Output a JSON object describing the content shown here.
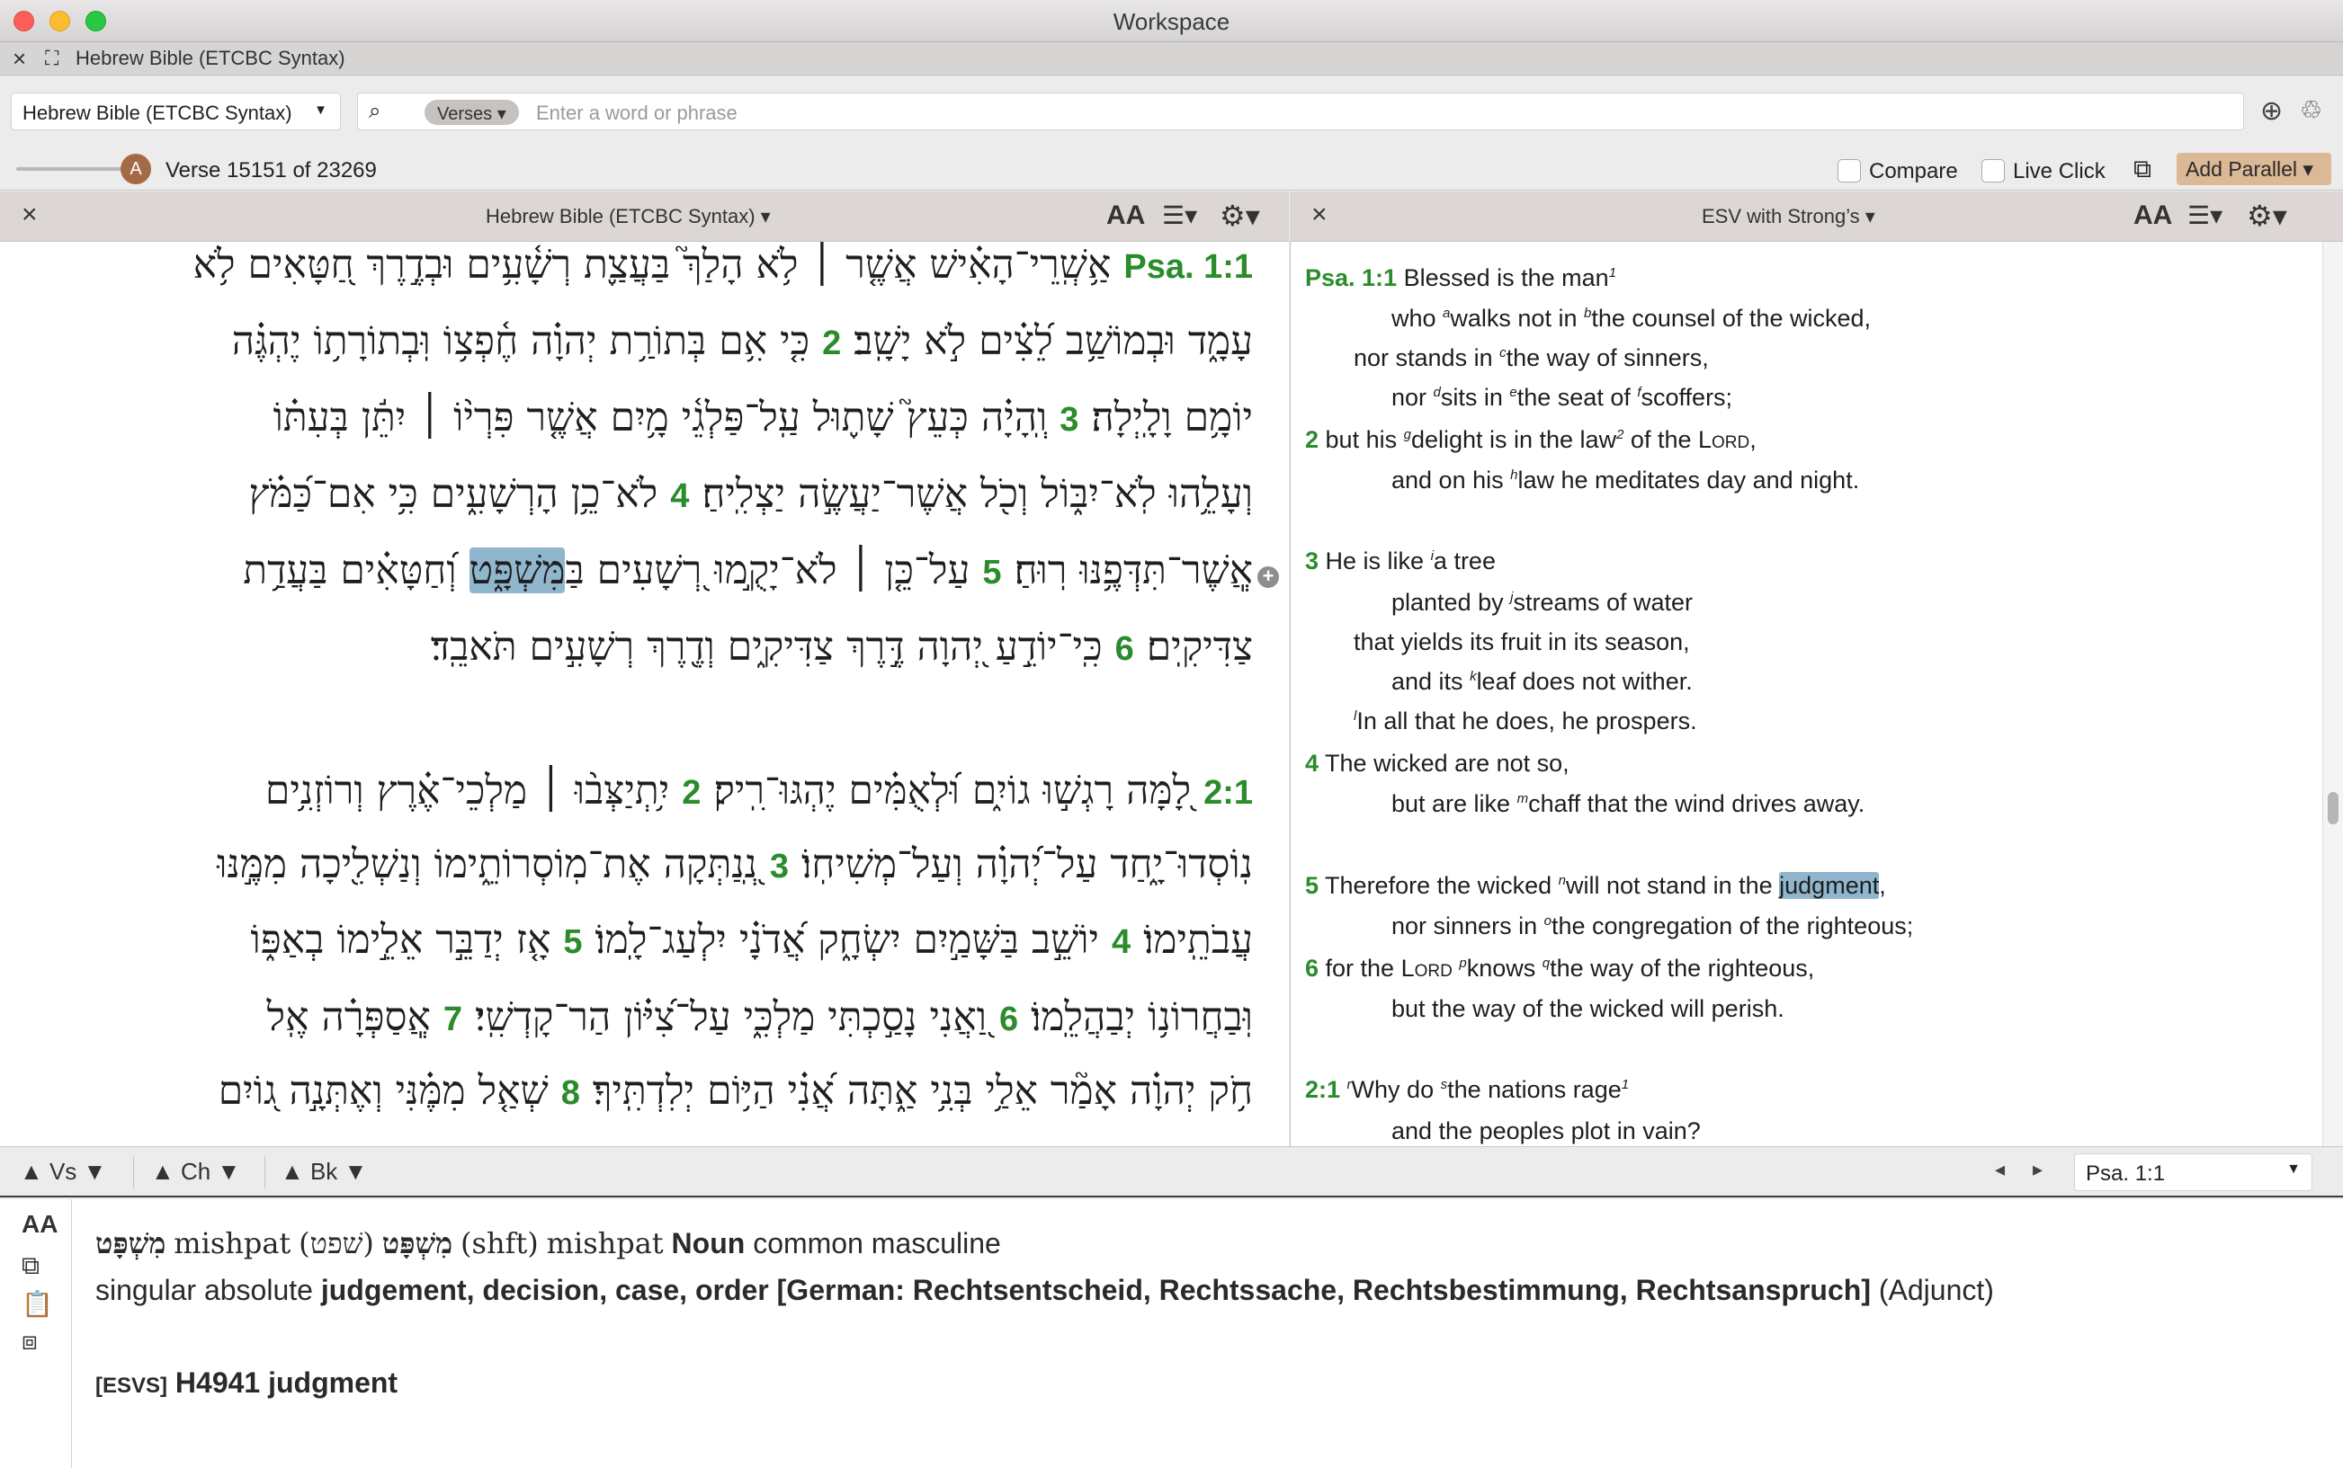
{
  "window": {
    "title": "Workspace"
  },
  "tab": {
    "title": "Hebrew Bible (ETCBC Syntax)"
  },
  "search": {
    "resource": "Hebrew Bible (ETCBC Syntax)",
    "scope": "Verses",
    "placeholder": "Enter a word or phrase"
  },
  "verse_bar": {
    "slider_badge": "A",
    "verse_count": "Verse 15151 of 23269",
    "compare_label": "Compare",
    "live_click_label": "Live Click",
    "add_parallel_label": "Add Parallel"
  },
  "left_pane": {
    "title": "Hebrew Bible (ETCBC Syntax)",
    "font_size_label": "AA",
    "lines": [
      {
        "parts": [
          {
            "t": "vn",
            "v": "Psa. 1:1"
          },
          {
            "t": "tx",
            "v": " אַ֥שְֽׁרֵי־הָאִ֗ישׁ אֲשֶׁ֤ר ׀ לֹ֥א הָלַךְ֮ בַּעֲצַ֪ת רְשָׁ֫עִ֥ים וּבְדֶ֣רֶךְ חַ֭טָּאִים לֹ֥א"
          }
        ]
      },
      {
        "parts": [
          {
            "t": "tx",
            "v": "עָמָ֑ד וּבְמוֹשַׁ֥ב לֵ֝צִ֗ים לֹ֣א יָשָֽׁב׃ "
          },
          {
            "t": "vn",
            "v": "2"
          },
          {
            "t": "tx",
            "v": " כִּ֤י אִ֥ם בְּתוֹרַ֥ת יְהוָ֗ה חֶ֫פְצ֥וֹ וּֽבְתוֹרָת֥וֹ יֶהְגֶּ֗ה"
          }
        ]
      },
      {
        "parts": [
          {
            "t": "tx",
            "v": "יוֹמָ֥ם וָלָֽיְלָה׃ "
          },
          {
            "t": "vn",
            "v": "3"
          },
          {
            "t": "tx",
            "v": " וְֽהָיָ֗ה כְּעֵץ֮ שָׁת֪וּל עַֽל־פַּלְגֵ֫י מָ֥יִם אֲשֶׁ֤ר פִּרְי֨וֹ ׀ יִתֵּ֬ן בְּעִתּ֗וֹ"
          }
        ]
      },
      {
        "parts": [
          {
            "t": "tx",
            "v": "וְעָלֵ֥הוּ לֹֽא־יִבּ֑וֹל וְכֹ֖ל אֲשֶׁר־יַעֲשֶׂ֣ה יַצְלִֽיחַ׃ "
          },
          {
            "t": "vn",
            "v": "4"
          },
          {
            "t": "tx",
            "v": " לֹא־כֵ֥ן הָרְשָׁעִ֑ים כִּ֥י אִם־כַּ֝מֹּ֗ץ"
          }
        ]
      },
      {
        "parts": [
          {
            "t": "tx",
            "v": "אֲֽשֶׁר־תִּדְּפֶ֥נּוּ רֽוּחַ׃ "
          },
          {
            "t": "vn",
            "v": "5"
          },
          {
            "t": "tx",
            "v": " עַל־כֵּ֤ן ׀ לֹא־יָקֻ֣מוּ רְ֭שָׁעִים בַּ"
          },
          {
            "t": "hl",
            "v": "מִּשְׁפָּ֑ט"
          },
          {
            "t": "tx",
            "v": " וְ֝חַטָּאִ֗ים בַּעֲדַ֥ת"
          }
        ]
      },
      {
        "parts": [
          {
            "t": "tx",
            "v": "צַדִּיקִֽים׃ "
          },
          {
            "t": "vn",
            "v": "6"
          },
          {
            "t": "tx",
            "v": " כִּֽי־יוֹדֵ֣עַ יְ֭הוָה דֶּ֣רֶךְ צַדִּיקִ֑ים וְדֶ֖רֶךְ רְשָׁעִ֣ים תֹּאבֵֽד׃"
          }
        ]
      },
      {
        "parts": [
          {
            "t": "vn",
            "v": "2:1"
          },
          {
            "t": "tx",
            "v": " לָ֭מָּה רָגְשׁ֣וּ גוֹיִ֑ם וּ֝לְאֻמִּ֗ים יֶהְגּוּ־רִֽיק׃ "
          },
          {
            "t": "vn",
            "v": "2"
          },
          {
            "t": "tx",
            "v": " יִ֥תְיַצְּב֨וּ ׀ מַלְכֵי־אֶ֗רֶץ וְרוֹזְנִ֥ים"
          }
        ]
      },
      {
        "parts": [
          {
            "t": "tx",
            "v": "נֽוֹסְדוּ־יָ֑חַד עַל־יְ֝הוָ֗ה וְעַל־מְשִׁיחֽוֹ׃ "
          },
          {
            "t": "vn",
            "v": "3"
          },
          {
            "t": "tx",
            "v": " נְֽ֭נַתְּקָה אֶת־מֽוֹסְרוֹתֵ֑ימוֹ וְנַשְׁלִ֖יכָה מִמֶּ֣נּוּ"
          }
        ]
      },
      {
        "parts": [
          {
            "t": "tx",
            "v": "עֲבֹתֵֽימוֹ׃ "
          },
          {
            "t": "vn",
            "v": "4"
          },
          {
            "t": "tx",
            "v": " יוֹשֵׁ֣ב בַּשָּׁמַ֣יִם יִשְׂחָ֑ק אֲ֝דֹנָ֗י יִלְעַג־לָֽמוֹ׃ "
          },
          {
            "t": "vn",
            "v": "5"
          },
          {
            "t": "tx",
            "v": " אָ֤ז יְדַבֵּ֣ר אֵלֵ֣ימוֹ בְאַפּ֑וֹ"
          }
        ]
      },
      {
        "parts": [
          {
            "t": "tx",
            "v": "וּֽבַחֲרוֹנ֥וֹ יְבַהֲלֵֽמוֹ׃ "
          },
          {
            "t": "vn",
            "v": "6"
          },
          {
            "t": "tx",
            "v": " וַ֭אֲנִי נָסַ֣כְתִּי מַלְכִּ֑י עַל־צִ֝יּ֗וֹן הַר־קָדְשִֽׁי׃ "
          },
          {
            "t": "vn",
            "v": "7"
          },
          {
            "t": "tx",
            "v": " אֲֽסַפְּרָ֗ה אֶֽל"
          }
        ]
      },
      {
        "parts": [
          {
            "t": "tx",
            "v": "חֹ֥ק יְהוָ֗ה אָמַ֘ר אֵלַ֥י בְּנִ֥י אַ֑תָּה אֲ֝נִ֗י הַיּ֥וֹם יְלִדְתִּֽיךָ׃ "
          },
          {
            "t": "vn",
            "v": "8"
          },
          {
            "t": "tx",
            "v": " שְׁאַ֤ל מִמֶּ֗נִּי וְאֶתְּנָ֣ה ג֭וֹיִם"
          }
        ]
      }
    ]
  },
  "right_pane": {
    "title": "ESV with Strong’s",
    "font_size_label": "AA",
    "lines": [
      {
        "parts": [
          {
            "t": "vn",
            "v": "Psa. 1:1"
          },
          {
            "t": "tx",
            "v": " Blessed is the man"
          },
          {
            "t": "fn",
            "v": "1"
          }
        ]
      },
      {
        "parts": [
          {
            "t": "tx",
            "v": "who "
          },
          {
            "t": "fn",
            "v": "a"
          },
          {
            "t": "tx",
            "v": "walks not in "
          },
          {
            "t": "fn",
            "v": "b"
          },
          {
            "t": "tx",
            "v": "the counsel of the wicked,"
          }
        ]
      },
      {
        "parts": [
          {
            "t": "tx",
            "v": "nor stands in "
          },
          {
            "t": "fn",
            "v": "c"
          },
          {
            "t": "tx",
            "v": "the way of sinners,"
          }
        ]
      },
      {
        "parts": [
          {
            "t": "tx",
            "v": "nor "
          },
          {
            "t": "fn",
            "v": "d"
          },
          {
            "t": "tx",
            "v": "sits in "
          },
          {
            "t": "fn",
            "v": "e"
          },
          {
            "t": "tx",
            "v": "the seat of "
          },
          {
            "t": "fn",
            "v": "f"
          },
          {
            "t": "tx",
            "v": "scoffers;"
          }
        ]
      },
      {
        "parts": [
          {
            "t": "vn",
            "v": "2"
          },
          {
            "t": "tx",
            "v": "  but his "
          },
          {
            "t": "fn",
            "v": "g"
          },
          {
            "t": "tx",
            "v": "delight is in the law"
          },
          {
            "t": "fn",
            "v": "2"
          },
          {
            "t": "tx",
            "v": " of the "
          },
          {
            "t": "sc",
            "v": "Lord"
          },
          {
            "t": "tx",
            "v": ","
          }
        ]
      },
      {
        "parts": [
          {
            "t": "tx",
            "v": "and on his "
          },
          {
            "t": "fn",
            "v": "h"
          },
          {
            "t": "tx",
            "v": "law he meditates day and night."
          }
        ]
      },
      {
        "parts": [
          {
            "t": "vn",
            "v": "3"
          },
          {
            "t": "tx",
            "v": "  He is like "
          },
          {
            "t": "fn",
            "v": "i"
          },
          {
            "t": "tx",
            "v": "a tree"
          }
        ]
      },
      {
        "parts": [
          {
            "t": "tx",
            "v": "planted by "
          },
          {
            "t": "fn",
            "v": "j"
          },
          {
            "t": "tx",
            "v": "streams of water"
          }
        ]
      },
      {
        "parts": [
          {
            "t": "tx",
            "v": "that yields its fruit in its season,"
          }
        ]
      },
      {
        "parts": [
          {
            "t": "tx",
            "v": "and its "
          },
          {
            "t": "fn",
            "v": "k"
          },
          {
            "t": "tx",
            "v": "leaf does not wither."
          }
        ]
      },
      {
        "parts": [
          {
            "t": "fn",
            "v": "l"
          },
          {
            "t": "tx",
            "v": "In all that he does, he prospers."
          }
        ]
      },
      {
        "parts": [
          {
            "t": "vn",
            "v": "4"
          },
          {
            "t": "tx",
            "v": "  The wicked are not so,"
          }
        ]
      },
      {
        "parts": [
          {
            "t": "tx",
            "v": "but are like "
          },
          {
            "t": "fn",
            "v": "m"
          },
          {
            "t": "tx",
            "v": "chaff that the wind drives away."
          }
        ]
      },
      {
        "parts": [
          {
            "t": "vn",
            "v": "5"
          },
          {
            "t": "tx",
            "v": "  Therefore the wicked "
          },
          {
            "t": "fn",
            "v": "n"
          },
          {
            "t": "tx",
            "v": "will not stand in the "
          },
          {
            "t": "hl",
            "v": "judgment"
          },
          {
            "t": "tx",
            "v": ","
          }
        ]
      },
      {
        "parts": [
          {
            "t": "tx",
            "v": "nor sinners in "
          },
          {
            "t": "fn",
            "v": "o"
          },
          {
            "t": "tx",
            "v": "the congregation of the righteous;"
          }
        ]
      },
      {
        "parts": [
          {
            "t": "vn",
            "v": "6"
          },
          {
            "t": "tx",
            "v": "  for the "
          },
          {
            "t": "sc",
            "v": "Lord"
          },
          {
            "t": "tx",
            "v": " "
          },
          {
            "t": "fn",
            "v": "p"
          },
          {
            "t": "tx",
            "v": "knows "
          },
          {
            "t": "fn",
            "v": "q"
          },
          {
            "t": "tx",
            "v": "the way of the righteous,"
          }
        ]
      },
      {
        "parts": [
          {
            "t": "tx",
            "v": "but the way of the wicked will perish."
          }
        ]
      },
      {
        "parts": [
          {
            "t": "vn",
            "v": "2:1"
          },
          {
            "t": "tx",
            "v": " "
          },
          {
            "t": "fn",
            "v": "r"
          },
          {
            "t": "tx",
            "v": "Why do "
          },
          {
            "t": "fn",
            "v": "s"
          },
          {
            "t": "tx",
            "v": "the nations rage"
          },
          {
            "t": "fn",
            "v": "1"
          }
        ]
      },
      {
        "parts": [
          {
            "t": "tx",
            "v": "and the peoples plot in vain?"
          }
        ]
      }
    ]
  },
  "nav_bar": {
    "verse_label": "Vs",
    "chapter_label": "Ch",
    "book_label": "Bk",
    "reference": "Psa. 1:1"
  },
  "info": {
    "lexeme_heb": "מִשְׁפָּט",
    "lexeme_translit": "mishpat",
    "lemma_heb": "מִשְׁפָּט",
    "root_heb": "(שׁפט)",
    "root_translit": "(shft)",
    "lemma_translit": "mishpat",
    "pos": "Noun",
    "pos_rest": "common masculine",
    "state": "singular absolute",
    "gloss": "judgement, decision, case, order [German: Rechtsentscheid, Rechtssache, Rechtsbestimmung, Rechtsanspruch]",
    "function": "(Adjunct)",
    "esvs_tag": "[ESVS]",
    "strongs": "H4941",
    "strongs_gloss": "judgment",
    "sidebar_font_label": "AA"
  },
  "colors": {
    "verse_number": "#2a8c2a",
    "highlight": "#8fb6cd",
    "pane_header": "#dcd7d4",
    "add_parallel": "#dbb896",
    "slider_knob": "#a46a45"
  }
}
